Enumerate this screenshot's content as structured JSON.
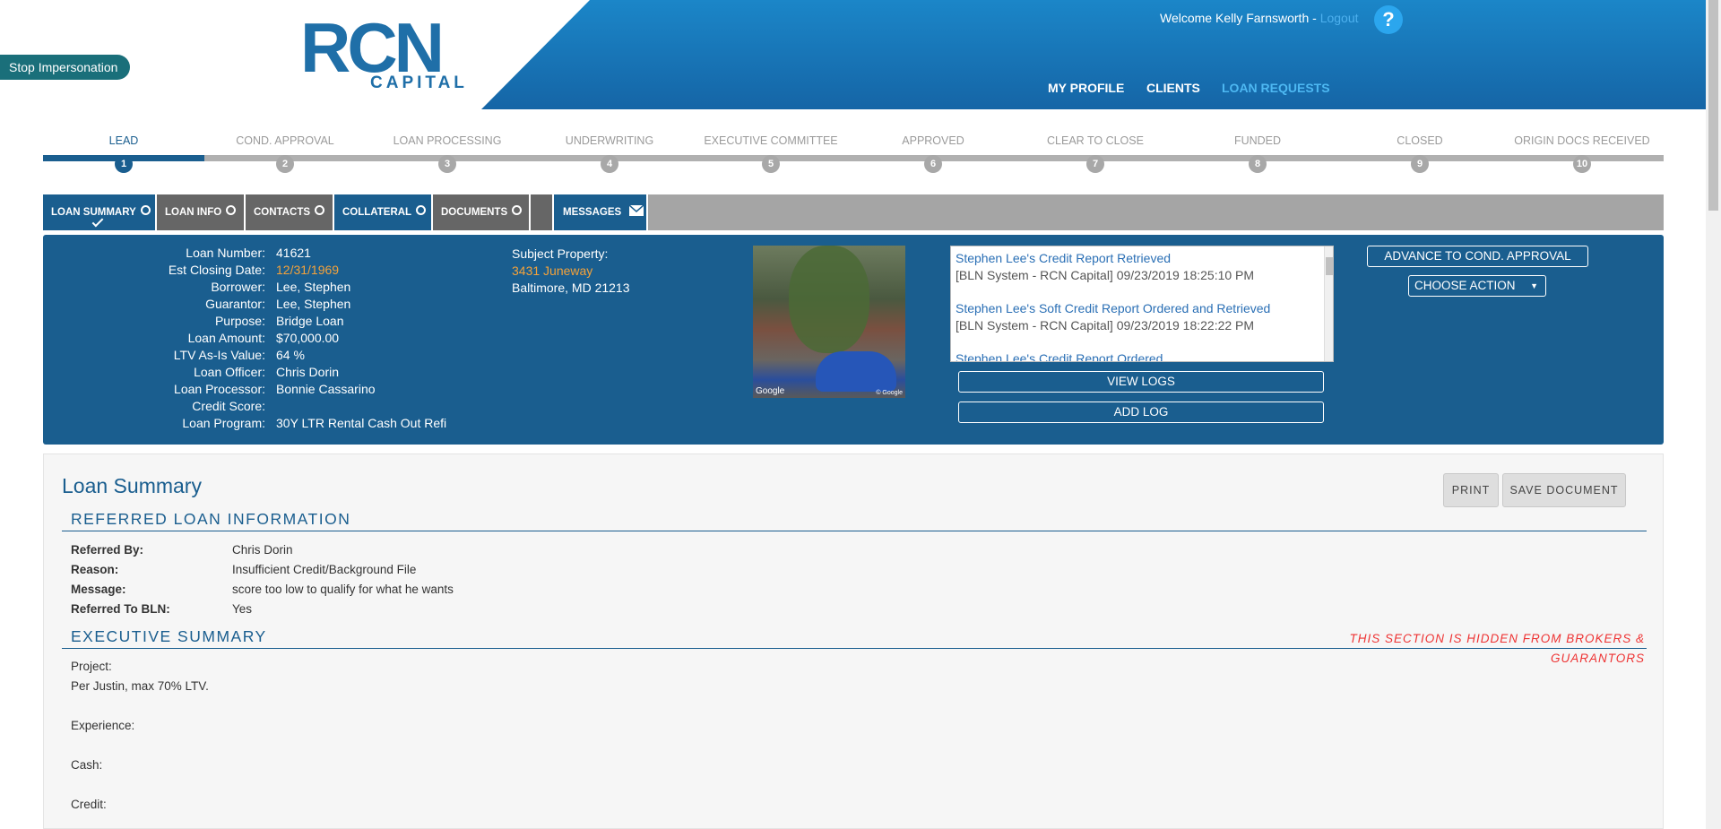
{
  "header": {
    "stop_impersonation": "Stop Impersonation",
    "logo_main": "RCN",
    "logo_sub": "CAPITAL",
    "welcome": "Welcome Kelly Farnsworth - ",
    "logout": "Logout",
    "help": "?",
    "nav": [
      "MY PROFILE",
      "CLIENTS",
      "LOAN REQUESTS"
    ],
    "brand_color": "#1a5e8f"
  },
  "steps": [
    {
      "label": "LEAD",
      "num": "1"
    },
    {
      "label": "COND. APPROVAL",
      "num": "2"
    },
    {
      "label": "LOAN PROCESSING",
      "num": "3"
    },
    {
      "label": "UNDERWRITING",
      "num": "4"
    },
    {
      "label": "EXECUTIVE COMMITTEE",
      "num": "5"
    },
    {
      "label": "APPROVED",
      "num": "6"
    },
    {
      "label": "CLEAR TO CLOSE",
      "num": "7"
    },
    {
      "label": "FUNDED",
      "num": "8"
    },
    {
      "label": "CLOSED",
      "num": "9"
    },
    {
      "label": "ORIGIN DOCS RECEIVED",
      "num": "10"
    }
  ],
  "tabs": [
    "LOAN SUMMARY",
    "LOAN INFO",
    "CONTACTS",
    "COLLATERAL",
    "DOCUMENTS",
    "",
    "MESSAGES"
  ],
  "loan": {
    "rows": [
      {
        "label": "Loan Number:",
        "value": "41621"
      },
      {
        "label": "Est Closing Date:",
        "value": "12/31/1969"
      },
      {
        "label": "Borrower:",
        "value": "Lee, Stephen"
      },
      {
        "label": "Guarantor:",
        "value": "Lee, Stephen"
      },
      {
        "label": "Purpose:",
        "value": "Bridge Loan"
      },
      {
        "label": "Loan Amount:",
        "value": "$70,000.00"
      },
      {
        "label": "LTV As-Is Value:",
        "value": "64 %"
      },
      {
        "label": "Loan Officer:",
        "value": "Chris Dorin"
      },
      {
        "label": "Loan Processor:",
        "value": "Bonnie Cassarino"
      },
      {
        "label": "Credit Score:",
        "value": ""
      },
      {
        "label": "Loan Program:",
        "value": "30Y LTR Rental Cash Out Refi"
      }
    ],
    "subject_label": "Subject Property:",
    "subject_street": "3431 Juneway",
    "subject_city": "Baltimore, MD 21213",
    "photo_credit": "Google",
    "photo_credit_2": "© Google"
  },
  "logs": [
    {
      "title": "Stephen Lee's Credit Report Retrieved",
      "meta": "[BLN System - RCN Capital] 09/23/2019 18:25:10 PM"
    },
    {
      "title": "Stephen Lee's Soft Credit Report Ordered and Retrieved",
      "meta": "[BLN System - RCN Capital] 09/23/2019 18:22:22 PM"
    },
    {
      "title": "Stephen Lee's Credit Report Ordered",
      "meta": ""
    }
  ],
  "actions": {
    "view_logs": "VIEW LOGS",
    "add_log": "ADD LOG",
    "advance": "ADVANCE TO COND. APPROVAL",
    "choose_action": "CHOOSE ACTION"
  },
  "summary": {
    "title": "Loan Summary",
    "print": "PRINT",
    "save": "SAVE DOCUMENT",
    "referred_heading": "REFERRED LOAN INFORMATION",
    "referred": [
      {
        "label": "Referred By:",
        "value": "Chris Dorin"
      },
      {
        "label": "Reason:",
        "value": "Insufficient Credit/Background File"
      },
      {
        "label": "Message:",
        "value": "score too low to qualify for what he wants"
      },
      {
        "label": "Referred To BLN:",
        "value": "Yes"
      }
    ],
    "exec_heading": "EXECUTIVE SUMMARY",
    "hidden_note": "THIS SECTION IS HIDDEN FROM BROKERS & GUARANTORS",
    "exec_lines": [
      "Project:",
      "Per Justin, max 70% LTV.",
      "Experience:",
      "Cash:",
      "Credit:"
    ]
  }
}
